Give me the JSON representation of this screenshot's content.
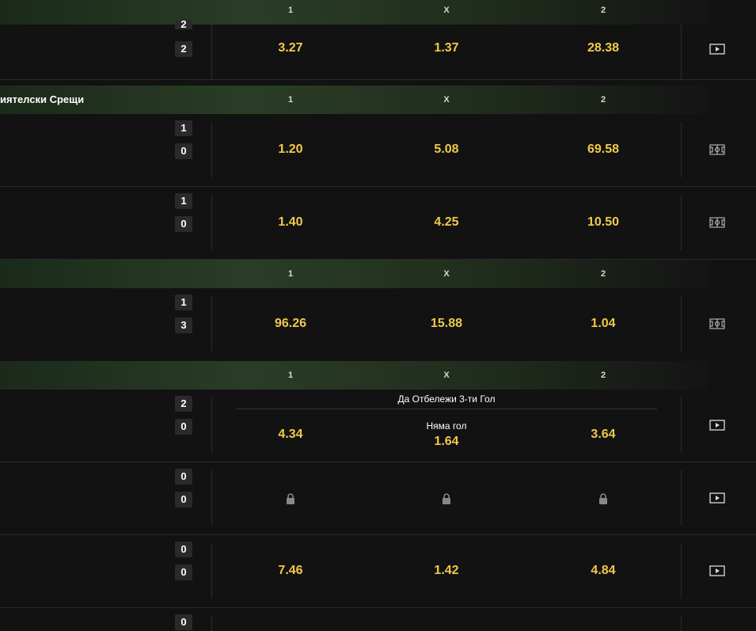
{
  "col_labels": {
    "home": "1",
    "draw": "X",
    "away": "2"
  },
  "headers": [
    {
      "title": ""
    },
    {
      "title": "иятелски Срещи"
    },
    {
      "title": ""
    },
    {
      "title": ""
    }
  ],
  "rows": [
    {
      "score_top": "2",
      "score_bottom": "2",
      "odds": [
        "3.27",
        "1.37",
        "28.38"
      ],
      "media_icon": "play-icon"
    },
    {
      "score_top": "1",
      "score_bottom": "0",
      "odds": [
        "1.20",
        "5.08",
        "69.58"
      ],
      "media_icon": "field-icon"
    },
    {
      "score_top": "1",
      "score_bottom": "0",
      "odds": [
        "1.40",
        "4.25",
        "10.50"
      ],
      "media_icon": "field-icon"
    },
    {
      "score_top": "1",
      "score_bottom": "3",
      "odds": [
        "96.26",
        "15.88",
        "1.04"
      ],
      "media_icon": "field-icon"
    },
    {
      "score_top": "2",
      "score_bottom": "0",
      "odds": [
        "4.34",
        "1.64",
        "3.64"
      ],
      "market_title": "Да Отбележи 3-ти Гол",
      "market_sub": "Няма гол",
      "media_icon": "play-icon"
    },
    {
      "score_top": "0",
      "score_bottom": "0",
      "odds": [
        "locked",
        "locked",
        "locked"
      ],
      "media_icon": "play-icon"
    },
    {
      "score_top": "0",
      "score_bottom": "0",
      "odds": [
        "7.46",
        "1.42",
        "4.84"
      ],
      "media_icon": "play-icon"
    },
    {
      "score_top": "0"
    }
  ],
  "colors": {
    "odd": "#f0c94a",
    "background": "#121212",
    "score_bg": "#2a2a2a"
  }
}
